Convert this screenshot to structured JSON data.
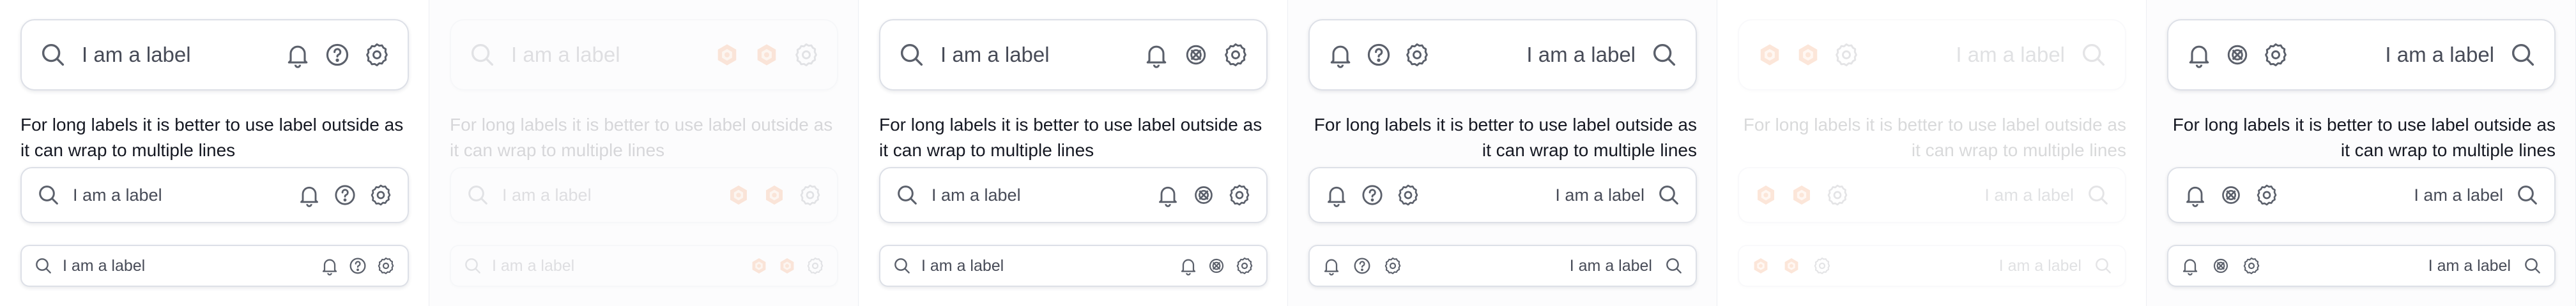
{
  "theme": {
    "accent_orange": "#f26b1d",
    "icon_gray": "#5b606b",
    "border": "#dde0e7"
  },
  "field_label": "I am a label",
  "outside_label_note": "For long labels it is better to use label outside as it can wrap to multiple lines",
  "panels": [
    {
      "id": "p1",
      "variant": "default",
      "align": "left",
      "icons": [
        "bell-icon",
        "help-icon",
        "settings-icon"
      ]
    },
    {
      "id": "p2",
      "variant": "disabled",
      "align": "left",
      "icons": [
        "broken-icon",
        "broken-icon",
        "settings-icon"
      ]
    },
    {
      "id": "p3",
      "variant": "default",
      "align": "left",
      "icons": [
        "bell-icon",
        "unknown-icon",
        "settings-icon"
      ]
    },
    {
      "id": "p4",
      "variant": "default",
      "align": "right",
      "icons": [
        "settings-icon",
        "help-icon",
        "bell-icon"
      ]
    },
    {
      "id": "p5",
      "variant": "disabled",
      "align": "right",
      "icons": [
        "settings-icon",
        "broken-icon",
        "broken-icon"
      ]
    },
    {
      "id": "p6",
      "variant": "default",
      "align": "right",
      "icons": [
        "settings-icon",
        "unknown-icon",
        "bell-icon"
      ]
    }
  ]
}
